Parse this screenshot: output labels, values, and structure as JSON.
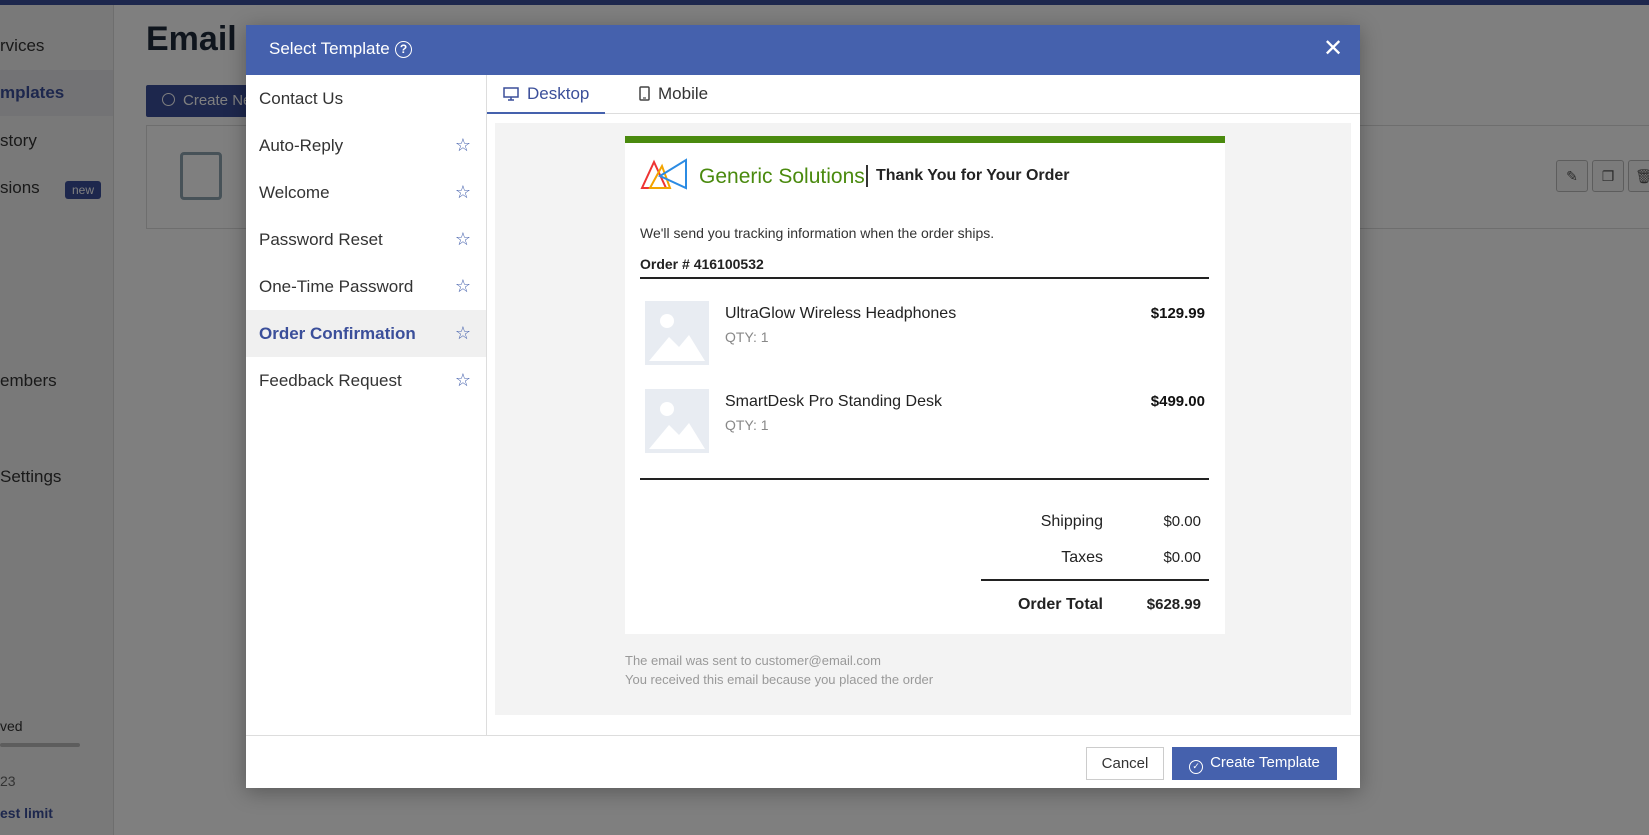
{
  "background": {
    "sidebar": {
      "items": [
        {
          "label": "rvices"
        },
        {
          "label": "mplates"
        },
        {
          "label": "story"
        },
        {
          "label": "sions"
        },
        {
          "label": "embers"
        },
        {
          "label": "Settings"
        },
        {
          "label": "ved"
        },
        {
          "label": "23"
        },
        {
          "label": "est limit"
        }
      ],
      "new_badge": "new"
    },
    "page_title": "Email T",
    "create_button": "Create New"
  },
  "modal": {
    "title": "Select Template",
    "templates": [
      {
        "label": "Contact Us",
        "starred": false
      },
      {
        "label": "Auto-Reply",
        "starred": true
      },
      {
        "label": "Welcome",
        "starred": true
      },
      {
        "label": "Password Reset",
        "starred": true
      },
      {
        "label": "One-Time Password",
        "starred": true
      },
      {
        "label": "Order Confirmation",
        "starred": true
      },
      {
        "label": "Feedback Request",
        "starred": true
      }
    ],
    "selected_template": "Order Confirmation",
    "tabs": [
      {
        "label": "Desktop",
        "icon": "monitor-icon"
      },
      {
        "label": "Mobile",
        "icon": "phone-icon"
      }
    ],
    "active_tab": "Desktop",
    "email": {
      "brand": "Generic Solutions",
      "title": "Thank You for Your Order",
      "message": "We'll send you tracking information when the order ships.",
      "order_number": "Order # 416100532",
      "items": [
        {
          "name": "UltraGlow Wireless Headphones",
          "qty": "QTY: 1",
          "price": "$129.99"
        },
        {
          "name": "SmartDesk Pro Standing Desk",
          "qty": "QTY: 1",
          "price": "$499.00"
        }
      ],
      "shipping_label": "Shipping",
      "shipping_value": "$0.00",
      "taxes_label": "Taxes",
      "taxes_value": "$0.00",
      "total_label": "Order Total",
      "total_value": "$628.99",
      "accent_color": "#4a8a0e"
    },
    "footer_lines": [
      "The email was sent to customer@email.com",
      "You received this email because you placed the order"
    ],
    "cancel_label": "Cancel",
    "create_label": "Create Template"
  }
}
